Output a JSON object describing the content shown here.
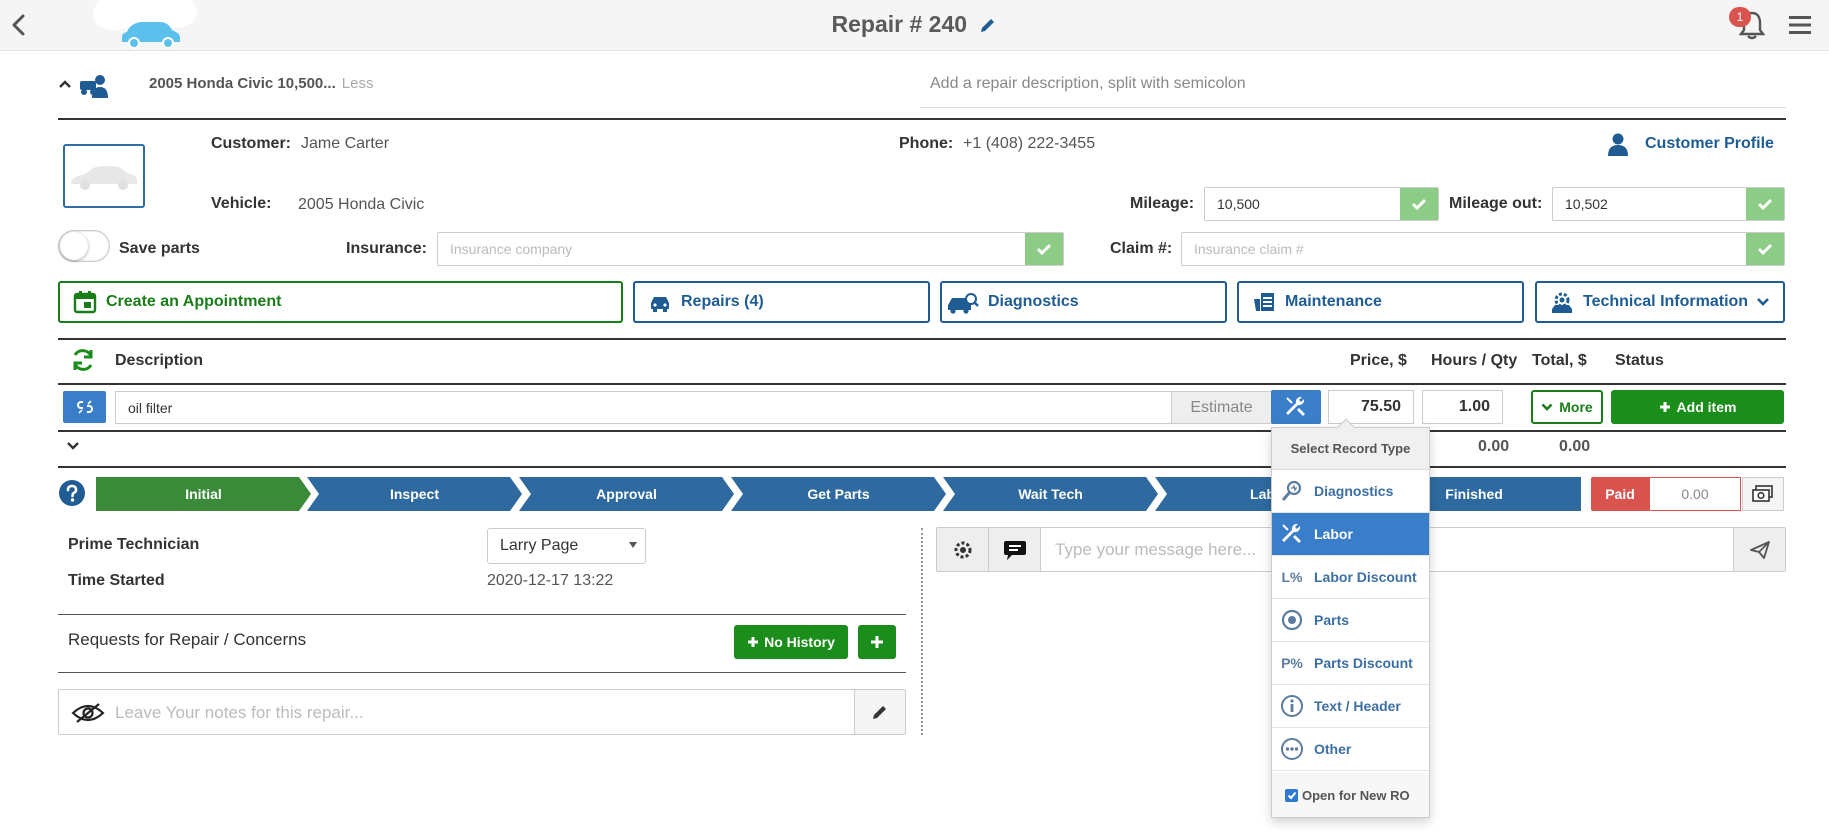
{
  "header": {
    "title": "Repair # 240",
    "notification_count": "1"
  },
  "summary": {
    "vehicle_short": "2005 Honda Civic 10,500...",
    "less_link": "Less",
    "repair_description_placeholder": "Add a repair description, split with semicolon"
  },
  "customer": {
    "customer_label": "Customer:",
    "customer_name": "Jame Carter",
    "phone_label": "Phone:",
    "phone": "+1 (408) 222-3455",
    "profile_link": "Customer Profile",
    "vehicle_label": "Vehicle:",
    "vehicle": "2005 Honda Civic",
    "mileage_label": "Mileage:",
    "mileage": "10,500",
    "mileage_out_label": "Mileage out:",
    "mileage_out": "10,502",
    "save_parts_label": "Save parts",
    "insurance_label": "Insurance:",
    "insurance_placeholder": "Insurance company",
    "claim_label": "Claim #:",
    "claim_placeholder": "Insurance claim #"
  },
  "actions": {
    "appointment": "Create an Appointment",
    "repairs": "Repairs (4)",
    "diagnostics": "Diagnostics",
    "maintenance": "Maintenance",
    "tech_info": "Technical Information"
  },
  "table": {
    "headers": {
      "description": "Description",
      "price": "Price, $",
      "hours_qty": "Hours / Qty",
      "total": "Total, $",
      "status": "Status"
    },
    "item": {
      "description": "oil filter",
      "estimate_label": "Estimate",
      "price": "75.50",
      "qty": "1.00",
      "more_label": "More",
      "add_item_label": "Add item"
    },
    "totals": {
      "subtotal_a": "0.00",
      "subtotal_b": "0.00"
    }
  },
  "steps": [
    "Initial",
    "Inspect",
    "Approval",
    "Get Parts",
    "Wait Tech",
    "Lab",
    "Finished"
  ],
  "payment": {
    "paid_label": "Paid",
    "paid_amount": "0.00"
  },
  "details": {
    "prime_tech_label": "Prime Technician",
    "prime_tech_value": "Larry Page",
    "time_started_label": "Time Started",
    "time_started_value": "2020-12-17 13:22",
    "requests_title": "Requests for Repair / Concerns",
    "no_history_label": "No History",
    "notes_placeholder": "Leave Your notes for this repair..."
  },
  "chat": {
    "placeholder": "Type your message here..."
  },
  "dropdown": {
    "title": "Select Record Type",
    "items": [
      {
        "label": "Diagnostics",
        "icon": "diagnostics-icon"
      },
      {
        "label": "Labor",
        "icon": "wrench-icon"
      },
      {
        "label": "Labor Discount",
        "icon": "labor-discount-icon",
        "glyph": "L%"
      },
      {
        "label": "Parts",
        "icon": "parts-icon"
      },
      {
        "label": "Parts Discount",
        "icon": "parts-discount-icon",
        "glyph": "P%"
      },
      {
        "label": "Text / Header",
        "icon": "info-icon"
      },
      {
        "label": "Other",
        "icon": "ellipsis-icon"
      }
    ],
    "active_item": "Labor",
    "open_for_new_ro": "Open for New RO"
  },
  "colors": {
    "brand_blue": "#1f5c94",
    "button_blue": "#3a7dc8",
    "green": "#1a8d1a",
    "light_green": "#8ccc87",
    "step_done": "#3a8a3a",
    "step_todo": "#2e6aa0",
    "paid_red": "#d9534f"
  }
}
